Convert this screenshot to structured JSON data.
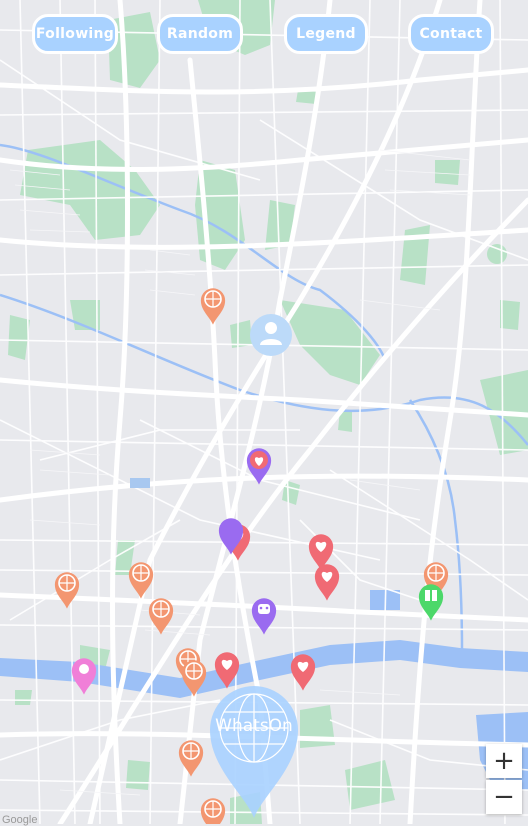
{
  "nav": {
    "following": "Following",
    "random": "Random",
    "legend": "Legend",
    "contact": "Contact"
  },
  "logo_text": "WhatsOn",
  "zoom": {
    "in": "+",
    "out": "−"
  },
  "attribution": "Google",
  "colors": {
    "button": "#a9d2ff",
    "sport_marker": "#f39670",
    "heart_marker": "#f06a74",
    "purple_marker": "#9a6bf0",
    "green_marker": "#4cd86a",
    "pink_marker": "#f07fd8",
    "river": "#9cc0f6",
    "park": "#b5e0c4"
  }
}
